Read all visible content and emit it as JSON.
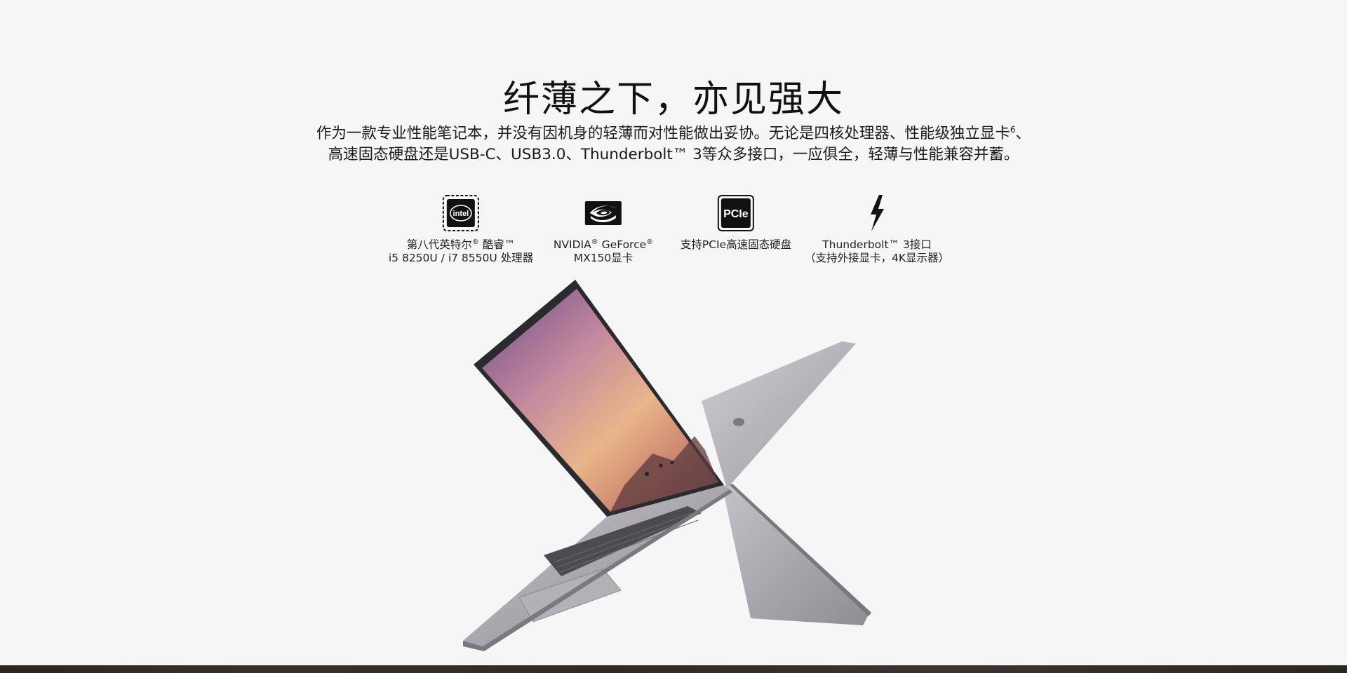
{
  "section": {
    "title": "纤薄之下，亦见强大",
    "description_line1": "作为一款专业性能笔记本，并没有因机身的轻薄而对性能做出妥协。无论是四核处理器、性能级独立显卡",
    "description_sup": "6",
    "description_line1_end": "、",
    "description_line2": "高速固态硬盘还是USB-C、USB3.0、Thunderbolt™ 3等众多接口，一应俱全，轻薄与性能兼容并蓄。"
  },
  "features": [
    {
      "icon": "intel-icon",
      "icon_text": "intel",
      "line1_main": "第八代英特尔",
      "line1_sup": "®",
      "line1_rest": " 酷睿™",
      "line2": "i5 8250U / i7 8550U 处理器"
    },
    {
      "icon": "nvidia-icon",
      "line1_main": "NVIDIA",
      "line1_sup": "®",
      "line1_rest": " GeForce",
      "line1_sup2": "®",
      "line2": "MX150显卡"
    },
    {
      "icon": "pcie-icon",
      "icon_text": "PCIe",
      "line1": "支持PCIe高速固态硬盘"
    },
    {
      "icon": "thunderbolt-icon",
      "line1": "Thunderbolt™ 3接口",
      "line2": "（支持外接显卡，4K显示器）"
    }
  ],
  "colors": {
    "background": "#f6f6f6",
    "text": "#111111",
    "laptop_body": "#a7a4ab",
    "icon": "#111111"
  }
}
